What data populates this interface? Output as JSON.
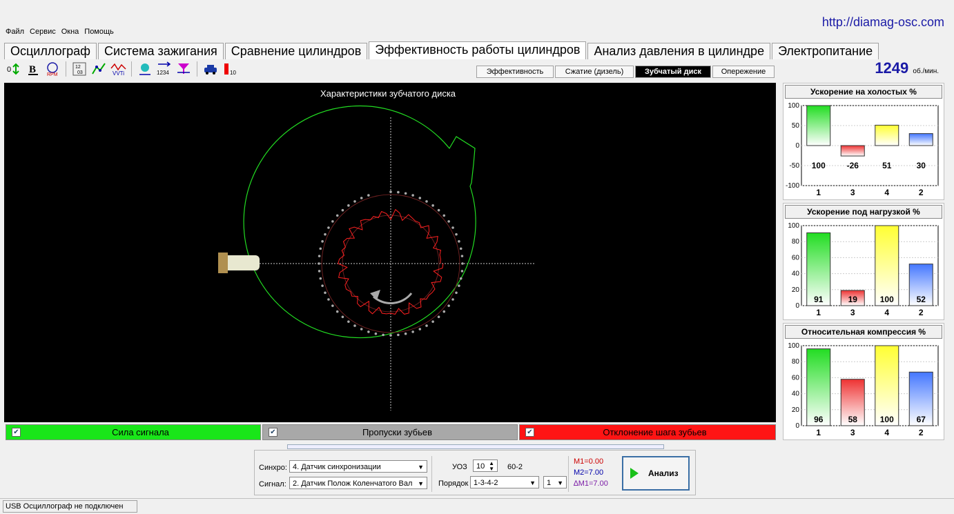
{
  "url": "http://diamag-osc.com",
  "menu": [
    "Файл",
    "Сервис",
    "Окна",
    "Помощь"
  ],
  "tabs": [
    "Осциллограф",
    "Система зажигания",
    "Сравнение цилиндров",
    "Эффективность работы цилиндров",
    "Анализ давления в цилиндре",
    "Электропитание"
  ],
  "active_tab": "Эффективность работы цилиндров",
  "subtabs": [
    "Эффективность",
    "Сжатие (дизель)",
    "Зубчатый диск",
    "Опережение"
  ],
  "active_subtab": "Зубчатый диск",
  "rpm": {
    "value": "1249",
    "unit": "об./мин."
  },
  "scope": {
    "title": "Характеристики зубчатого диска",
    "buttons": [
      {
        "label": "Сила сигнала",
        "color": "#19e619"
      },
      {
        "label": "Пропуски зубьев",
        "color": "#a8a8a8"
      },
      {
        "label": "Отклонение шага зубьев",
        "color": "#ff1414"
      }
    ]
  },
  "chart_data": [
    {
      "type": "bar",
      "title": "Ускорение на холостых %",
      "categories": [
        "1",
        "3",
        "4",
        "2"
      ],
      "values": [
        100,
        -26,
        51,
        30
      ],
      "ylim": [
        -100,
        100
      ],
      "yticks": [
        "100",
        "50",
        "0",
        "-50",
        "-100"
      ],
      "data_labels": [
        "100",
        "-26",
        "51",
        "30"
      ]
    },
    {
      "type": "bar",
      "title": "Ускорение под нагрузкой %",
      "categories": [
        "1",
        "3",
        "4",
        "2"
      ],
      "values": [
        91,
        19,
        100,
        52
      ],
      "ylim": [
        0,
        100
      ],
      "yticks": [
        "100",
        "80",
        "60",
        "40",
        "20",
        "0"
      ],
      "data_labels": [
        "91",
        "19",
        "100",
        "52"
      ]
    },
    {
      "type": "bar",
      "title": "Относительная компрессия %",
      "categories": [
        "1",
        "3",
        "4",
        "2"
      ],
      "values": [
        96,
        58,
        100,
        67
      ],
      "ylim": [
        0,
        100
      ],
      "yticks": [
        "100",
        "80",
        "60",
        "40",
        "20",
        "0"
      ],
      "data_labels": [
        "96",
        "58",
        "100",
        "67"
      ]
    }
  ],
  "bar_colors": [
    "#22dd22",
    "#ee3333",
    "#ffff33",
    "#4477ff"
  ],
  "controls": {
    "sync_label": "Синхро:",
    "sync_value": "4.  Датчик синхронизации",
    "signal_label": "Сигнал:",
    "signal_value": "2.  Датчик Полож Коленчатого Вал",
    "uoz_label": "УОЗ",
    "uoz_value": "10",
    "teeth": "60-2",
    "order_label": "Порядок",
    "order_value": "1-3-4-2",
    "order_num": "1",
    "m1": "M1=0.00",
    "m2": "M2=7.00",
    "dm1": "∆M1=7.00",
    "analyze_label": "Анализ"
  },
  "status": "USB Осциллограф не подключен"
}
